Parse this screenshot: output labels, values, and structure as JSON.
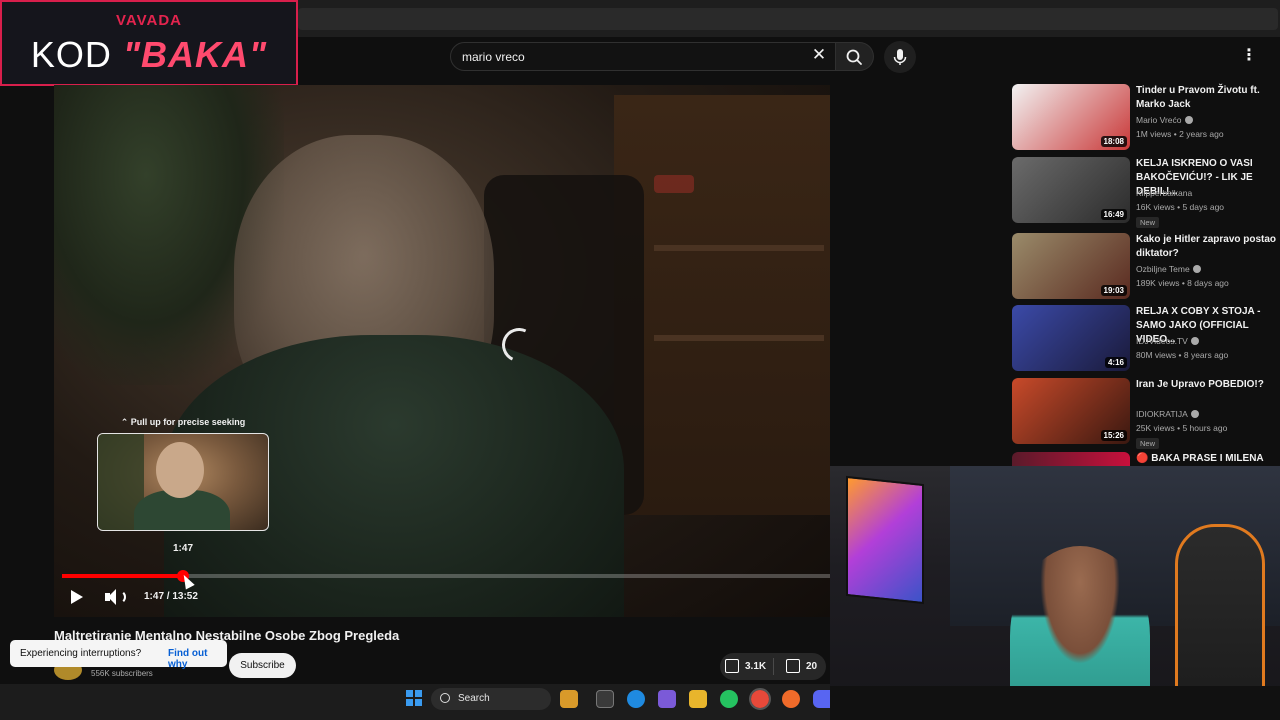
{
  "sponsor": {
    "brand": "VAVADA",
    "code_prefix": "KOD ",
    "code_highlight": "\"BAKA\""
  },
  "search": {
    "value": "mario vreco"
  },
  "player": {
    "seek_hint": "⌃ Pull up for precise seeking",
    "preview_time": "1:47",
    "time_display": "1:47 / 13:52",
    "progress_fraction": 0.158
  },
  "video": {
    "title": "Maltretiranje Mentalno Nestabilne Osobe Zbog Pregleda",
    "subscribers": "556K subscribers",
    "subscribe_label": "Subscribe",
    "likes": "3.1K",
    "dislikes": "20"
  },
  "toast": {
    "text": "Experiencing interruptions?",
    "link": "Find out why"
  },
  "recommendations": [
    {
      "title": "Tinder u Pravom Životu ft. Marko Jack",
      "channel": "Mario Vrećo",
      "verified": true,
      "meta": "1M views • 2 years ago",
      "duration": "18:08",
      "new": "",
      "thumb_colors": [
        "#f2f2f2",
        "#c93838"
      ]
    },
    {
      "title": "KELJA ISKRENO O VASI BAKOČEVIĆU!? - LIK JE DEBIL!...",
      "channel": "Klipperbalkana",
      "verified": false,
      "meta": "16K views • 5 days ago",
      "duration": "16:49",
      "new": "New",
      "thumb_colors": [
        "#6b6b6b",
        "#2b2b2b"
      ]
    },
    {
      "title": "Kako je Hitler zapravo postao diktator?",
      "channel": "Ozbiljne Teme",
      "verified": true,
      "meta": "189K views • 8 days ago",
      "duration": "19:03",
      "new": "",
      "thumb_colors": [
        "#9a8b6a",
        "#5a2a20"
      ]
    },
    {
      "title": "RELJA X COBY X STOJA - SAMO JAKO (OFFICIAL VIDEO...",
      "channel": "IDJVideos.TV",
      "verified": true,
      "meta": "80M views • 8 years ago",
      "duration": "4:16",
      "new": "",
      "thumb_colors": [
        "#3b4aa8",
        "#1a1a3a"
      ]
    },
    {
      "title": "Iran Je Upravo POBEDIO!?",
      "channel": "IDIOKRATIJA",
      "verified": true,
      "meta": "25K views • 5 hours ago",
      "duration": "15:26",
      "new": "New",
      "thumb_colors": [
        "#c84a2a",
        "#3a1810"
      ]
    }
  ],
  "partial_rec": {
    "title": "🔴 BAKA PRASE I MILENA"
  },
  "taskbar": {
    "search_label": "Search"
  }
}
